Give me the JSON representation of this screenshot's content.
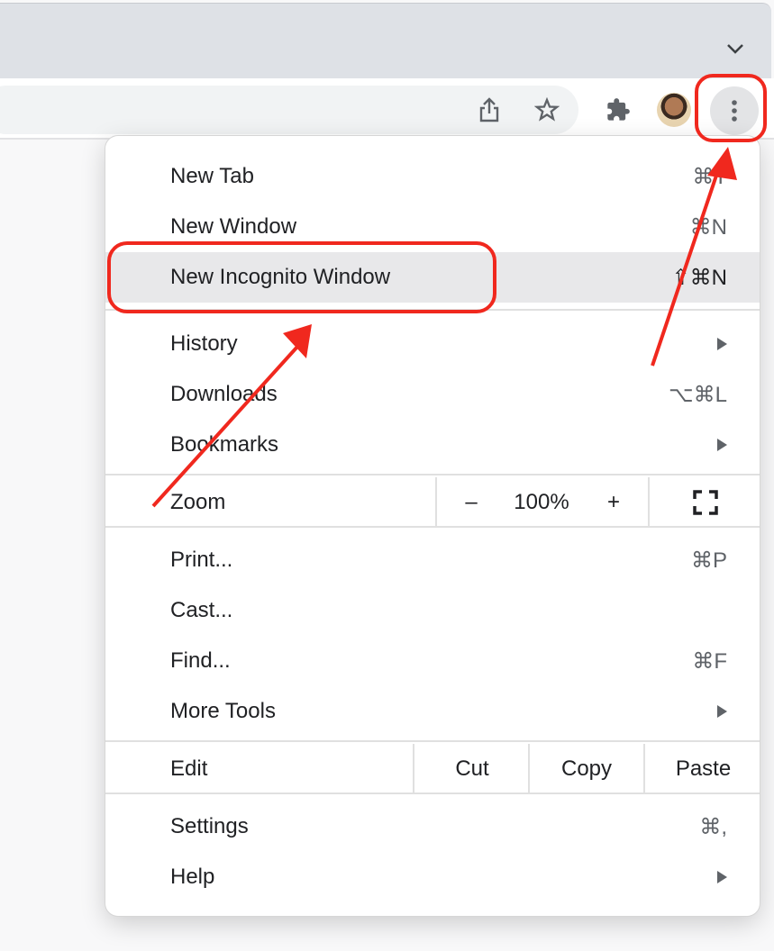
{
  "browser": {
    "tab_search_icon": "chevron-down-icon",
    "toolbar": {
      "share_icon": "share-icon",
      "bookmark_icon": "star-icon",
      "extensions_icon": "puzzle-icon",
      "profile_icon": "avatar",
      "menu_icon": "vertical-dots-icon"
    }
  },
  "menu": {
    "items": [
      {
        "label": "New Tab",
        "shortcut": "⌘T"
      },
      {
        "label": "New Window",
        "shortcut": "⌘N"
      },
      {
        "label": "New Incognito Window",
        "shortcut": "⇧⌘N"
      },
      {
        "label": "History",
        "submenu": true
      },
      {
        "label": "Downloads",
        "shortcut": "⌥⌘L"
      },
      {
        "label": "Bookmarks",
        "submenu": true
      },
      {
        "label": "Print...",
        "shortcut": "⌘P"
      },
      {
        "label": "Cast..."
      },
      {
        "label": "Find...",
        "shortcut": "⌘F"
      },
      {
        "label": "More Tools",
        "submenu": true
      },
      {
        "label": "Settings",
        "shortcut": "⌘,"
      },
      {
        "label": "Help",
        "submenu": true
      }
    ],
    "highlighted": "New Incognito Window",
    "zoom": {
      "label": "Zoom",
      "decrease": "–",
      "value": "100%",
      "increase": "+",
      "fullscreen_icon": "fullscreen-icon"
    },
    "edit": {
      "label": "Edit",
      "cut": "Cut",
      "copy": "Copy",
      "paste": "Paste"
    }
  },
  "annotations": {
    "color": "#f0281e",
    "circled": [
      "menu-button",
      "New Incognito Window"
    ],
    "arrows": 2
  }
}
